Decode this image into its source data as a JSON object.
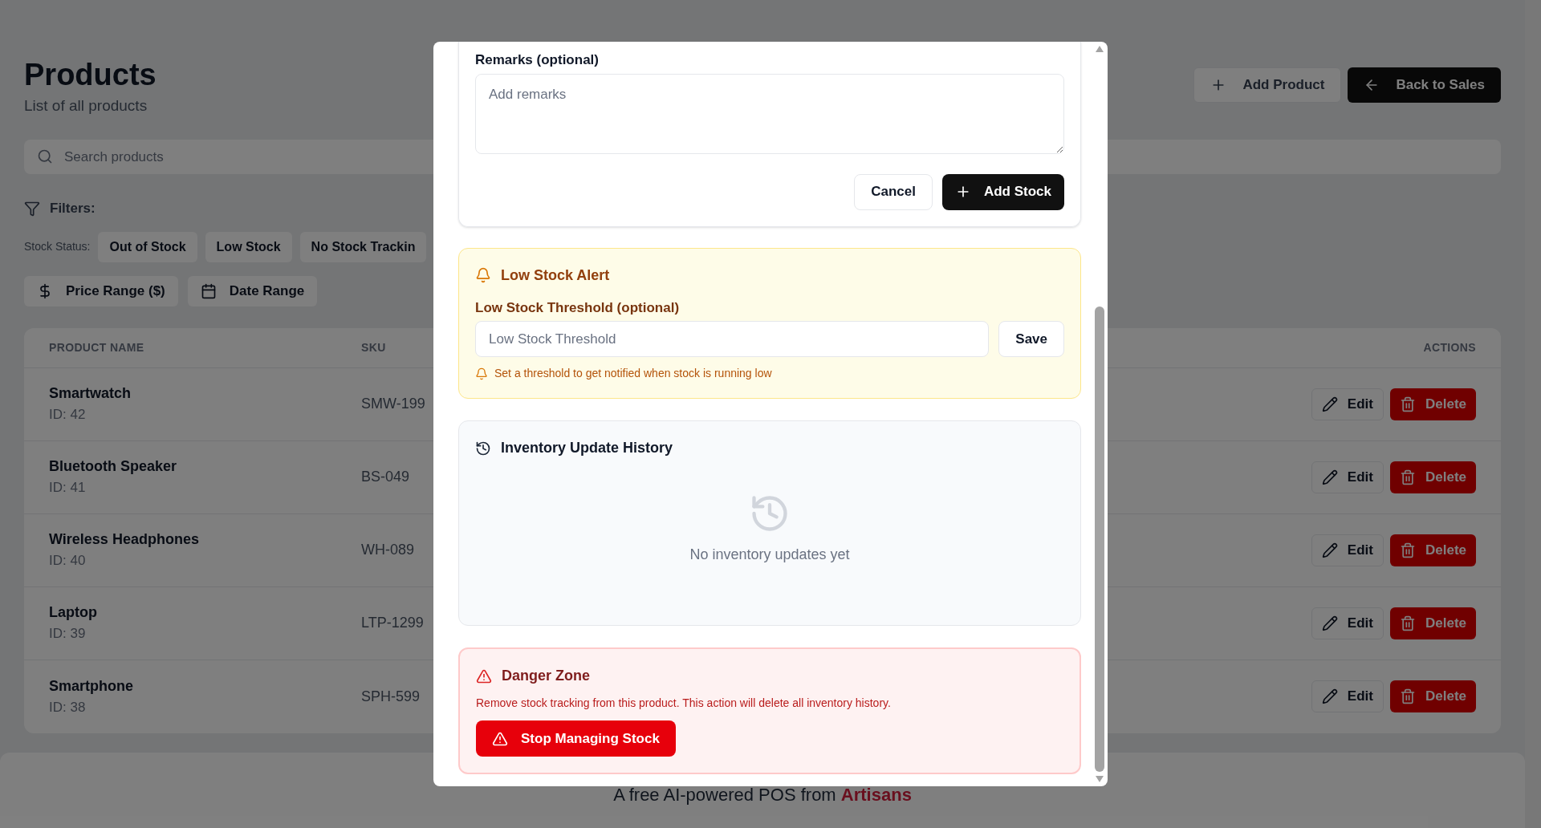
{
  "page": {
    "title": "Products",
    "subtitle": "List of all products",
    "actions": [
      {
        "label": "Add Product",
        "kind": "outline"
      },
      {
        "label": "Back to Sales",
        "kind": "dark"
      }
    ]
  },
  "search": {
    "placeholder": "Search products"
  },
  "filters": {
    "label": "Filters:",
    "stock_status_label": "Stock Status:",
    "stock_status": [
      "Out of Stock",
      "Low Stock",
      "No Stock Trackin"
    ],
    "ranges": [
      {
        "label": "Price Range ($)",
        "kind": "price"
      },
      {
        "label": "Date Range",
        "kind": "date"
      }
    ]
  },
  "table": {
    "columns": [
      "PRODUCT NAME",
      "SKU",
      "ACTIONS"
    ],
    "rows": [
      {
        "name": "Smartwatch",
        "id": "ID: 42",
        "sku": "SMW-199",
        "edit": "Edit",
        "delete": "Delete"
      },
      {
        "name": "Bluetooth Speaker",
        "id": "ID: 41",
        "sku": "BS-049",
        "edit": "Edit",
        "delete": "Delete"
      },
      {
        "name": "Wireless Headphones",
        "id": "ID: 40",
        "sku": "WH-089",
        "edit": "Edit",
        "delete": "Delete"
      },
      {
        "name": "Laptop",
        "id": "ID: 39",
        "sku": "LTP-1299",
        "edit": "Edit",
        "delete": "Delete"
      },
      {
        "name": "Smartphone",
        "id": "ID: 38",
        "sku": "SPH-599",
        "edit": "Edit",
        "delete": "Delete"
      }
    ]
  },
  "footer": {
    "text": "A free AI-powered POS from",
    "link": "Artisans"
  },
  "modal": {
    "remarks": {
      "label": "Remarks (optional)",
      "placeholder": "Add remarks"
    },
    "buttons": [
      {
        "label": "Cancel",
        "kind": "outline"
      },
      {
        "label": "Add Stock",
        "kind": "primary"
      }
    ],
    "low_stock": {
      "title": "Low Stock Alert",
      "field_label": "Low Stock Threshold (optional)",
      "placeholder": "Low Stock Threshold",
      "button": "Save",
      "hint": "Set a threshold to get notified when stock is running low"
    },
    "history": {
      "title": "Inventory Update History",
      "empty_text": "No inventory updates yet"
    },
    "danger": {
      "title": "Danger Zone",
      "text": "Remove stock tracking from this product. This action will delete all inventory history.",
      "button": "Stop Managing Stock"
    }
  }
}
